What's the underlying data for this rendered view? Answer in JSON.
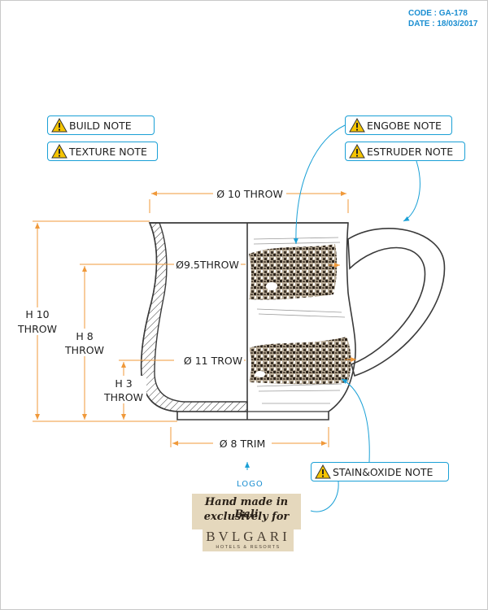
{
  "meta": {
    "code": "CODE : GA-178",
    "date": "DATE : 18/03/2017"
  },
  "notes": {
    "build": "BUILD NOTE",
    "texture": "TEXTURE NOTE",
    "engobe": "ENGOBE NOTE",
    "estruder": "ESTRUDER NOTE",
    "stain_oxide": "STAIN&OXIDE NOTE"
  },
  "dimensions": {
    "top_diameter": "Ø 10 THROW",
    "upper_diameter": "Ø9.5THROW",
    "lower_diameter": "Ø 11 TROW",
    "base_diameter": "Ø 8 TRIM",
    "height_total_1": "H 10",
    "height_total_2": "THROW",
    "height_mid_1": "H 8",
    "height_mid_2": "THROW",
    "height_low_1": "H 3",
    "height_low_2": "THROW"
  },
  "logo": {
    "marker": "LOGO",
    "handmade_line1": "Hand made in Bali",
    "handmade_line2": "exclusively for",
    "brand": "BVLGARI",
    "brand_sub": "HOTELS & RESORTS"
  },
  "colors": {
    "dimension": "#f0993a",
    "callout": "#1aa0d6",
    "warning": "#f5c400",
    "outline": "#3a3a3a"
  },
  "icons": {
    "warning": "warning-triangle-icon"
  }
}
